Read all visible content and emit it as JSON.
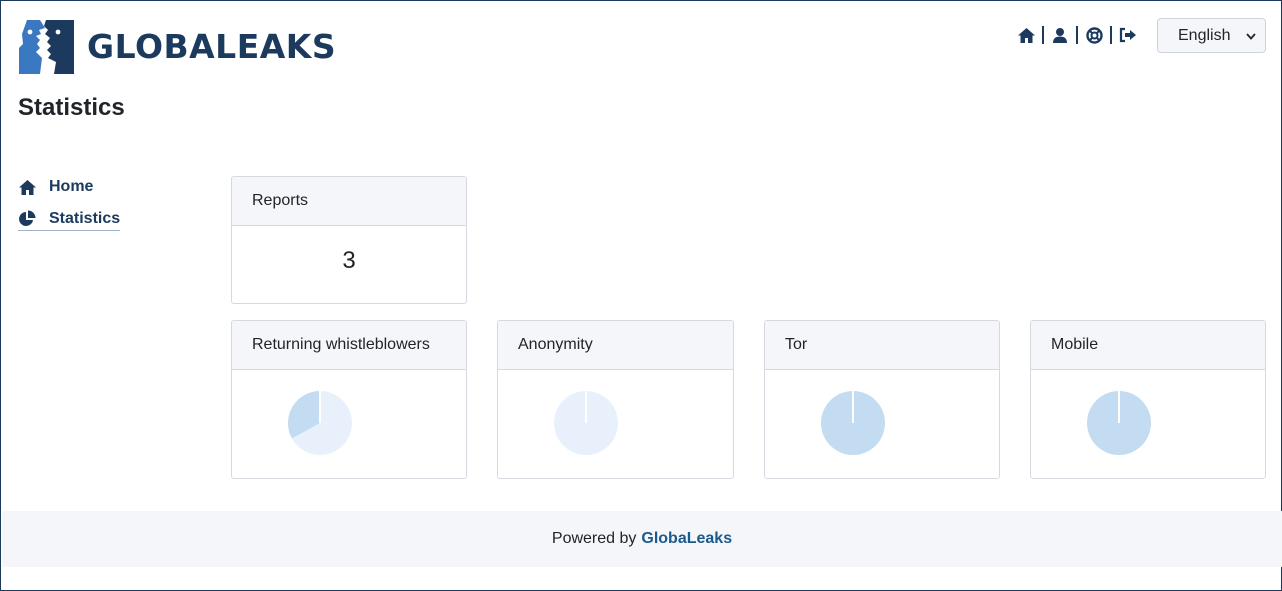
{
  "header": {
    "brand": "GLOBALEAKS",
    "language": "English",
    "nav_icons": [
      "home-icon",
      "user-icon",
      "help-icon",
      "logout-icon"
    ]
  },
  "page": {
    "title": "Statistics"
  },
  "sidebar": {
    "items": [
      {
        "label": "Home",
        "icon": "home-icon"
      },
      {
        "label": "Statistics",
        "icon": "pie-chart-icon",
        "active": true
      }
    ]
  },
  "cards": {
    "reports": {
      "title": "Reports",
      "value": "3"
    },
    "returning": {
      "title": "Returning whistleblowers",
      "fraction": 0.33
    },
    "anonymity": {
      "title": "Anonymity",
      "fraction": 0.0
    },
    "tor": {
      "title": "Tor",
      "fraction": 1.0
    },
    "mobile": {
      "title": "Mobile",
      "fraction": 1.0
    }
  },
  "colors": {
    "brand": "#1c3a5e",
    "pie_filled": "#c4dcf2",
    "pie_empty": "#e8f1fb"
  },
  "footer": {
    "prefix": "Powered by",
    "brand": "GlobaLeaks"
  }
}
